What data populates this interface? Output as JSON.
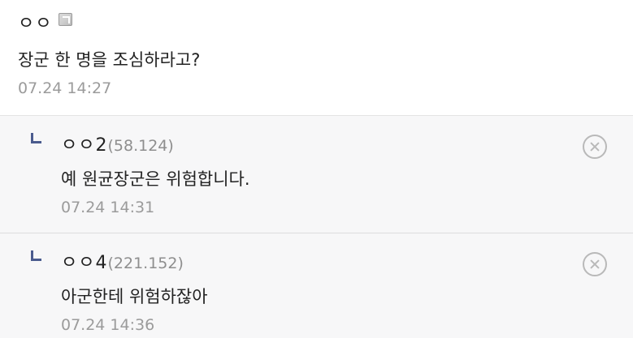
{
  "main_comment": {
    "nickname": "ㅇㅇ",
    "badge_icon": "fixed-nick-badge-icon",
    "text": "장군 한 명을 조심하라고?",
    "timestamp": "07.24 14:27"
  },
  "replies": [
    {
      "reply_marker_icon": "reply-arrow-icon",
      "nickname": "ㅇㅇ2",
      "ip": "(58.124)",
      "text": "예 원균장군은 위험합니다.",
      "timestamp": "07.24 14:31",
      "delete_icon": "delete-circle-x-icon"
    },
    {
      "reply_marker_icon": "reply-arrow-icon",
      "nickname": "ㅇㅇ4",
      "ip": "(221.152)",
      "text": "아군한테 위험하잖아",
      "timestamp": "07.24 14:36",
      "delete_icon": "delete-circle-x-icon"
    }
  ],
  "colors": {
    "reply_marker": "#4a5b8e",
    "reply_background": "#f7f7f8",
    "timestamp": "#9b9b9b",
    "ip_text": "#8e8e8e",
    "delete_icon": "#b9b9b9"
  }
}
